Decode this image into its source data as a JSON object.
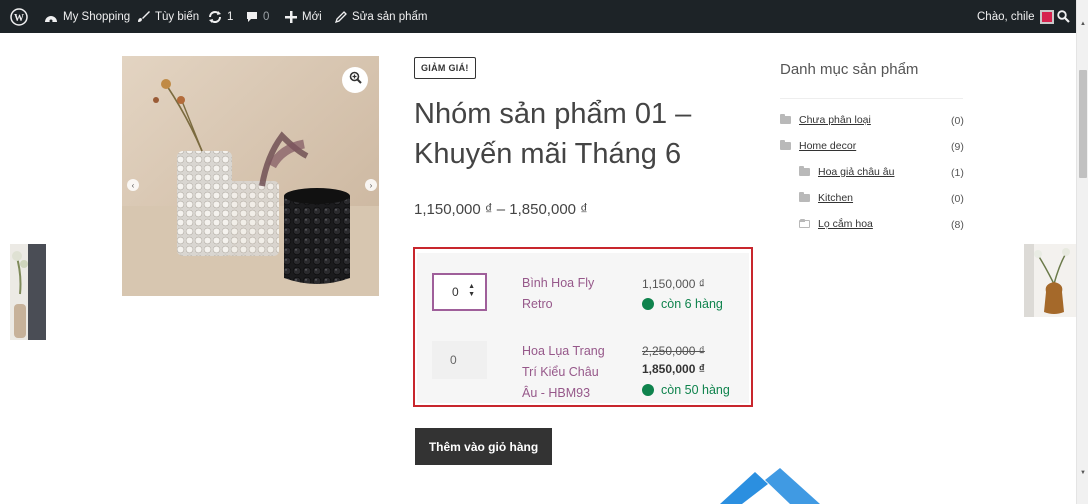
{
  "adminbar": {
    "site_name": "My Shopping",
    "customize": "Tùy biến",
    "updates_count": "1",
    "comments_count": "0",
    "new_label": "Mới",
    "edit_product": "Sửa sản phẩm",
    "greeting": "Chào, chile"
  },
  "product": {
    "sale_badge": "GIẢM GIÁ!",
    "title": "Nhóm sản phẩm 01 – Khuyến mãi Tháng 6",
    "price_range": "1,150,000 ₫ – 1,850,000 ₫",
    "add_to_cart": "Thêm vào giỏ hàng",
    "items": [
      {
        "qty": "0",
        "name_line1": "Bình Hoa Fly",
        "name_line2": "Retro",
        "price": "1,150,000 ₫",
        "stock": "còn 6 hàng"
      },
      {
        "qty": "0",
        "name_line1": "Hoa Lụa Trang",
        "name_line2": "Trí Kiểu Châu",
        "name_line3": "Âu - HBM93",
        "old_price": "2,250,000 ₫",
        "price": "1,850,000 ₫",
        "stock": "còn 50 hàng"
      }
    ]
  },
  "sidebar": {
    "title": "Danh mục sản phẩm",
    "categories": [
      {
        "label": "Chưa phân loại",
        "count": "(0)"
      },
      {
        "label": "Home decor",
        "count": "(9)"
      },
      {
        "label": "Hoa giả châu âu",
        "count": "(1)"
      },
      {
        "label": "Kitchen",
        "count": "(0)"
      },
      {
        "label": "Lọ cắm hoa",
        "count": "(8)"
      }
    ]
  },
  "colors": {
    "adminbar_bg": "#1d2327",
    "link_purple": "#96588a",
    "stock_green": "#0f834d",
    "highlight_red": "#c8262d",
    "button_dark": "#333333"
  },
  "icons": [
    "wordpress-icon",
    "dashboard-icon",
    "brush-icon",
    "update-icon",
    "comment-icon",
    "plus-icon",
    "pencil-icon",
    "search-icon",
    "zoom-icon",
    "folder-icon",
    "smiley-icon"
  ]
}
